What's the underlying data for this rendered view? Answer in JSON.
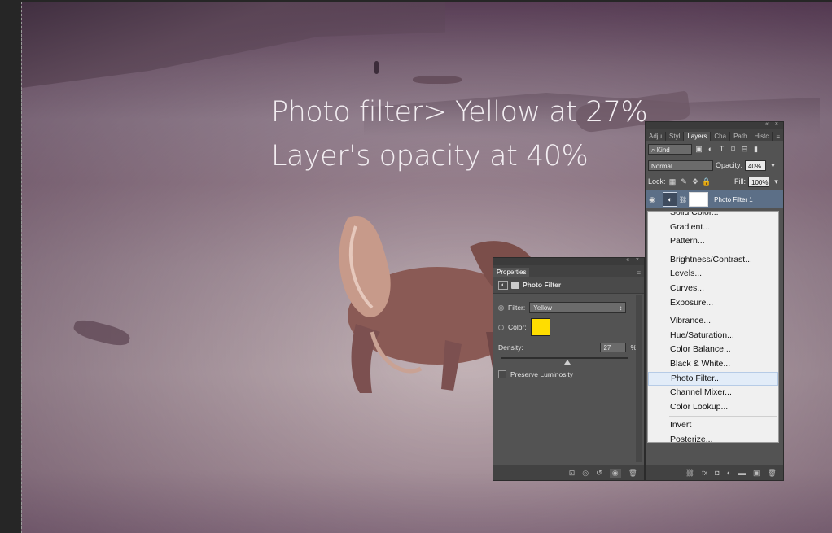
{
  "overlay": {
    "line1": "Photo filter> Yellow at 27%",
    "line2": "Layer's opacity at 40%"
  },
  "layers_panel": {
    "tabs": [
      "Adju",
      "Styl",
      "Layers",
      "Cha",
      "Path",
      "Histc"
    ],
    "active_tab": "Layers",
    "kind_label": "⌕ Kind",
    "blend_mode": "Normal",
    "opacity_label": "Opacity:",
    "opacity_value": "40%",
    "lock_label": "Lock:",
    "fill_label": "Fill:",
    "fill_value": "100%",
    "layer_name": "Photo Filter 1"
  },
  "adjustment_menu": {
    "items_group1": [
      "Solid Color...",
      "Gradient...",
      "Pattern..."
    ],
    "items_group2": [
      "Brightness/Contrast...",
      "Levels...",
      "Curves...",
      "Exposure..."
    ],
    "items_group3": [
      "Vibrance...",
      "Hue/Saturation...",
      "Color Balance...",
      "Black & White...",
      "Photo Filter...",
      "Channel Mixer...",
      "Color Lookup..."
    ],
    "items_group4": [
      "Invert",
      "Posterize..."
    ],
    "highlighted": "Photo Filter..."
  },
  "properties_panel": {
    "tab": "Properties",
    "title": "Photo Filter",
    "filter_label": "Filter:",
    "filter_value": "Yellow",
    "color_label": "Color:",
    "color_hex": "#ffdd00",
    "density_label": "Density:",
    "density_value": "27",
    "density_unit": "%",
    "density_fraction": 0.27,
    "preserve_label": "Preserve Luminosity"
  },
  "icons": {
    "panel_controls": "« ×",
    "panel_menu": "≡",
    "dropdown": "↕"
  }
}
